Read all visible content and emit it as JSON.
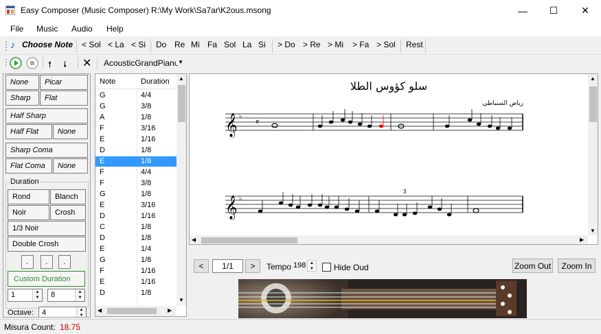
{
  "window": {
    "title": "Easy Composer (Music Composer) R:\\My Work\\Sa7ar\\K2ous.msong",
    "minimize": "—",
    "maximize": "☐",
    "close": "✕"
  },
  "menu": [
    "File",
    "Music",
    "Audio",
    "Help"
  ],
  "toolbar": {
    "choose_note": "Choose Note",
    "notes": [
      "< Sol",
      "< La",
      "< Si",
      "Do",
      "Re",
      "Mi",
      "Fa",
      "Sol",
      "La",
      "Si",
      "> Do",
      "> Re",
      "> Mi",
      "> Fa",
      "> Sol",
      "Rest"
    ]
  },
  "toolbar2": {
    "instrument": "AcousticGrandPiano",
    "play_icon": "play-icon",
    "stop_icon": "stop-icon",
    "up_icon": "arrow-up-icon",
    "down_icon": "arrow-down-icon",
    "delete_icon": "close-icon"
  },
  "accidentals": {
    "none1": "None",
    "picar": "Picar",
    "sharp": "Sharp",
    "flat": "Flat",
    "half_sharp": "Half Sharp",
    "half_flat": "Half Flat",
    "none2": "None",
    "sharp_coma": "Sharp Coma",
    "flat_coma": "Flat Coma",
    "none3": "None"
  },
  "duration": {
    "label": "Duration",
    "rond": "Rond",
    "blanch": "Blanch",
    "noir": "Noir",
    "crosh": "Crosh",
    "third_noir": "1/3 Noir",
    "double_crosh": "Double Crosh",
    "dots": [
      ".",
      ".",
      "."
    ],
    "custom": "Custom Duration",
    "num": "1",
    "den": "8"
  },
  "octave": {
    "label": "Octave:",
    "value": "4"
  },
  "notes_table": {
    "headers": [
      "Note",
      "Duration"
    ],
    "rows": [
      [
        "G",
        "4/4"
      ],
      [
        "G",
        "3/8"
      ],
      [
        "A",
        "1/8"
      ],
      [
        "F",
        "3/16"
      ],
      [
        "E",
        "1/16"
      ],
      [
        "D",
        "1/8"
      ],
      [
        "E",
        "1/8"
      ],
      [
        "F",
        "4/4"
      ],
      [
        "F",
        "3/8"
      ],
      [
        "G",
        "1/8"
      ],
      [
        "E",
        "3/16"
      ],
      [
        "D",
        "1/16"
      ],
      [
        "C",
        "1/8"
      ],
      [
        "D",
        "1/8"
      ],
      [
        "E",
        "1/4"
      ],
      [
        "G",
        "1/8"
      ],
      [
        "F",
        "1/16"
      ],
      [
        "E",
        "1/16"
      ],
      [
        "D",
        "1/8"
      ]
    ],
    "selected_index": 6
  },
  "score": {
    "title": "سلو كؤوس الطلا",
    "composer": "رياض السنباطي",
    "triplet": "3"
  },
  "nav": {
    "prev": "<",
    "page": "1/1",
    "next": ">",
    "tempo_label": "Tempo",
    "tempo_value": "198",
    "hide_oud": "Hide Oud",
    "zoom_out": "Zoom Out",
    "zoom_in": "Zoom In"
  },
  "status": {
    "label": "Misura Count:",
    "value": "18.75",
    "value_color": "#c00000"
  }
}
